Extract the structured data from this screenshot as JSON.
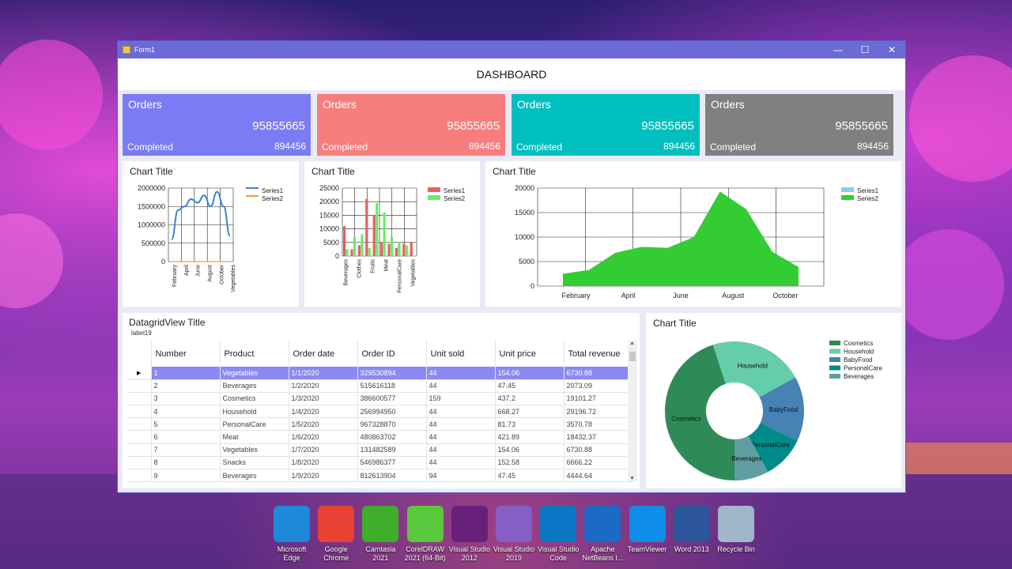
{
  "window": {
    "title": "Form1",
    "minimize": "—",
    "maximize": "☐",
    "close": "✕"
  },
  "header": {
    "title": "DASHBOARD"
  },
  "cards": [
    {
      "title": "Orders",
      "value": "95855665",
      "status": "Completed",
      "count": "894456",
      "color": "#7b7bf5"
    },
    {
      "title": "Orders",
      "value": "95855665",
      "status": "Completed",
      "count": "894456",
      "color": "#f87d7d"
    },
    {
      "title": "Orders",
      "value": "95855665",
      "status": "Completed",
      "count": "894456",
      "color": "#00bfbf"
    },
    {
      "title": "Orders",
      "value": "95855665",
      "status": "Completed",
      "count": "894456",
      "color": "#808080"
    }
  ],
  "chart_data": [
    {
      "type": "line",
      "title": "Chart Title",
      "x": [
        "February",
        "April",
        "June",
        "August",
        "October",
        "Vegetables"
      ],
      "series": [
        {
          "name": "Series1",
          "color": "#3a84d1",
          "values": [
            600000,
            1400000,
            1500000,
            1700000,
            1600000,
            1800000,
            1500000,
            1900000,
            1500000,
            700000
          ]
        },
        {
          "name": "Series2",
          "color": "#f0a030",
          "values": [
            0,
            0,
            0,
            0,
            0,
            0,
            0,
            0,
            0,
            0
          ]
        }
      ],
      "yticks": [
        "2000000",
        "1500000",
        "1000000",
        "500000",
        "0"
      ],
      "ylim": [
        0,
        2000000
      ],
      "legend": "top-right"
    },
    {
      "type": "bar",
      "title": "Chart Title",
      "categories": [
        "Beverages",
        "Clothes",
        "Fruits",
        "Meat",
        "PersonalCare",
        "Vegetables"
      ],
      "series": [
        {
          "name": "Series1",
          "color": "#e86060",
          "values": [
            11000,
            2500,
            4000,
            21000,
            15000,
            5000,
            4500,
            3000,
            4500,
            5000
          ]
        },
        {
          "name": "Series2",
          "color": "#66ee66",
          "values": [
            2500,
            7000,
            8000,
            3000,
            19500,
            16000,
            7000,
            5000,
            4000,
            0
          ]
        }
      ],
      "yticks": [
        "25000",
        "20000",
        "15000",
        "10000",
        "5000",
        "0"
      ],
      "ylim": [
        0,
        25000
      ],
      "legend": "top-right"
    },
    {
      "type": "area",
      "title": "Chart Title",
      "x": [
        "February",
        "April",
        "June",
        "August",
        "October"
      ],
      "series": [
        {
          "name": "Series1",
          "color": "#87ceeb",
          "values": []
        },
        {
          "name": "Series2",
          "color": "#33cc33",
          "values": [
            2500,
            3300,
            6800,
            8000,
            7800,
            10000,
            19300,
            15700,
            7000,
            3900
          ]
        }
      ],
      "yticks": [
        "20000",
        "15000",
        "10000",
        "5000",
        "0"
      ],
      "ylim": [
        0,
        20000
      ],
      "legend": "top-right"
    },
    {
      "type": "pie",
      "title": "Chart Title",
      "slices": [
        {
          "label": "Cosmetics",
          "value": 45,
          "color": "#2e8b57"
        },
        {
          "label": "Household",
          "value": 22,
          "color": "#66cdaa"
        },
        {
          "label": "BabyFood",
          "value": 15,
          "color": "#4682b4"
        },
        {
          "label": "PersonalCare",
          "value": 10,
          "color": "#008b8b"
        },
        {
          "label": "Beverages",
          "value": 8,
          "color": "#5f9ea0"
        }
      ],
      "legend": "top-right"
    }
  ],
  "grid": {
    "title": "DatagridView Title",
    "label": "label19",
    "columns": [
      "Number",
      "Product",
      "Order date",
      "Order ID",
      "Unit sold",
      "Unit price",
      "Total revenue"
    ],
    "rows": [
      [
        "1",
        "Vegetables",
        "1/1/2020",
        "329530894",
        "44",
        "154.06",
        "6730.88"
      ],
      [
        "2",
        "Beverages",
        "1/2/2020",
        "515616118",
        "44",
        "47.45",
        "2073.09"
      ],
      [
        "3",
        "Cosmetics",
        "1/3/2020",
        "386600577",
        "159",
        "437.2",
        "19101.27"
      ],
      [
        "4",
        "Household",
        "1/4/2020",
        "256994950",
        "44",
        "668.27",
        "29196.72"
      ],
      [
        "5",
        "PersonalCare",
        "1/5/2020",
        "967328870",
        "44",
        "81.73",
        "3570.78"
      ],
      [
        "6",
        "Meat",
        "1/6/2020",
        "480863702",
        "44",
        "421.89",
        "18432.37"
      ],
      [
        "7",
        "Vegetables",
        "1/7/2020",
        "131482589",
        "44",
        "154.06",
        "6730.88"
      ],
      [
        "8",
        "Snacks",
        "1/8/2020",
        "546986377",
        "44",
        "152.58",
        "6666.22"
      ],
      [
        "9",
        "Beverages",
        "1/9/2020",
        "812613904",
        "94",
        "47.45",
        "4444.64"
      ]
    ]
  },
  "taskbar": [
    {
      "label": "Microsoft Edge",
      "icon": "edge-icon",
      "color": "#1e88d9"
    },
    {
      "label": "Google Chrome",
      "icon": "chrome-icon",
      "color": "#e94235"
    },
    {
      "label": "Camtasia 2021",
      "icon": "camtasia-icon",
      "color": "#3fae2a"
    },
    {
      "label": "CorelDRAW 2021 (64-Bit)",
      "icon": "coreldraw-icon",
      "color": "#5ac83c"
    },
    {
      "label": "Visual Studio 2012",
      "icon": "visual-studio-icon",
      "color": "#68217a"
    },
    {
      "label": "Visual Studio 2019",
      "icon": "visual-studio-icon",
      "color": "#865fc5"
    },
    {
      "label": "Visual Studio Code",
      "icon": "vscode-icon",
      "color": "#0a76c4"
    },
    {
      "label": "Apache NetBeans I...",
      "icon": "netbeans-icon",
      "color": "#1b6ac6"
    },
    {
      "label": "TeamViewer",
      "icon": "teamviewer-icon",
      "color": "#0e8ee9"
    },
    {
      "label": "Word 2013",
      "icon": "word-icon",
      "color": "#2b579a"
    },
    {
      "label": "Recycle Bin",
      "icon": "recycle-bin-icon",
      "color": "#9fb7c9"
    }
  ]
}
